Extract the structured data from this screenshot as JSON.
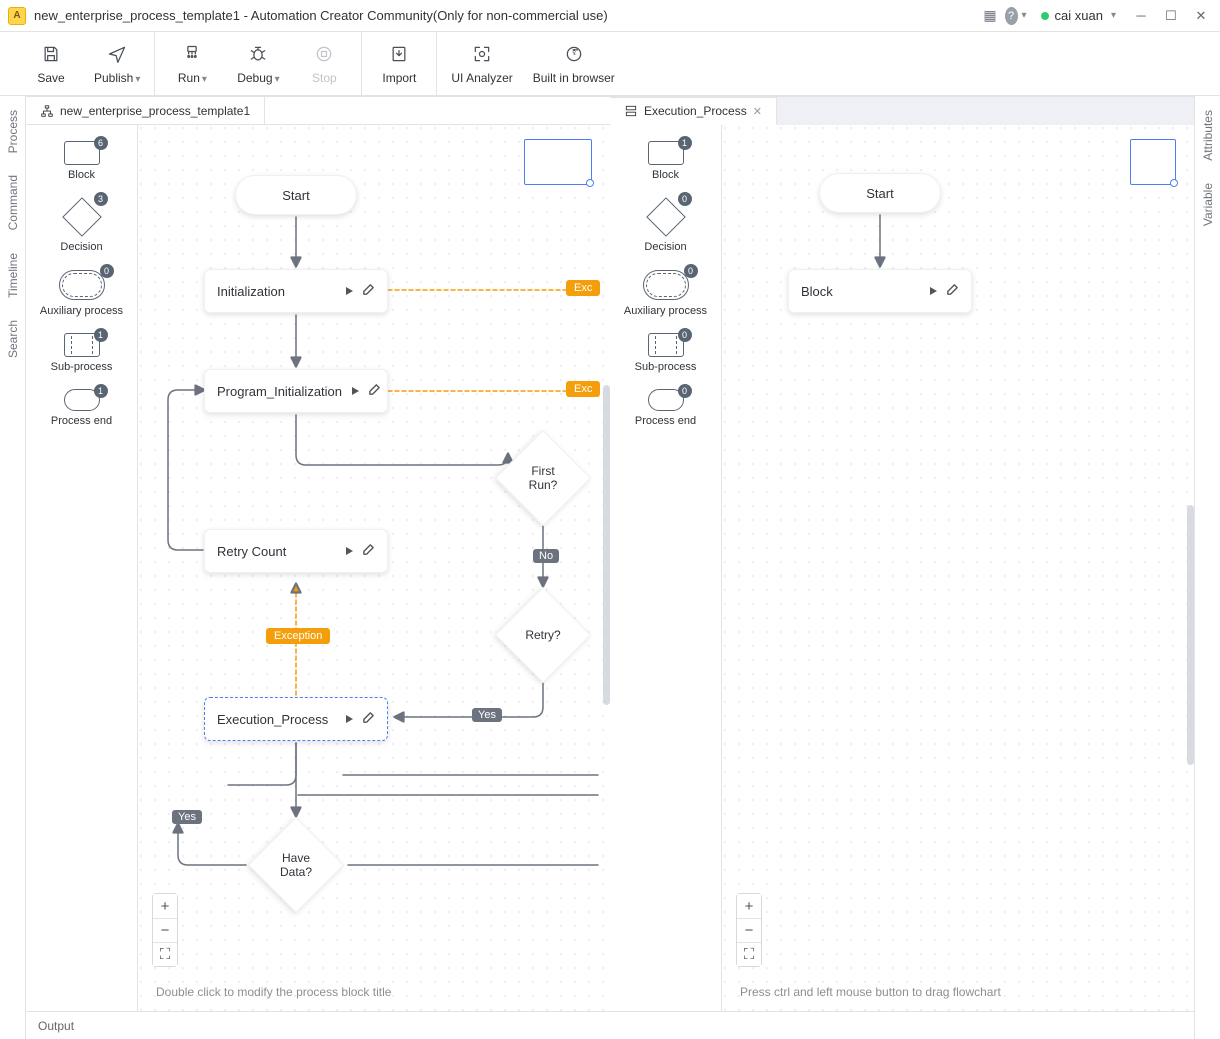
{
  "window": {
    "title": "new_enterprise_process_template1 - Automation Creator Community(Only for non-commercial use)",
    "user": "cai xuan"
  },
  "toolbar": {
    "save": "Save",
    "publish": "Publish",
    "run": "Run",
    "debug": "Debug",
    "stop": "Stop",
    "import": "Import",
    "analyzer": "UI Analyzer",
    "browser": "Built in browser"
  },
  "left_rail": {
    "process": "Process",
    "command": "Command",
    "timeline": "Timeline",
    "search": "Search"
  },
  "right_rail": {
    "attributes": "Attributes",
    "variable": "Variable"
  },
  "tabs": {
    "main": "new_enterprise_process_template1",
    "exec": "Execution_Process"
  },
  "palette_left": {
    "block": {
      "label": "Block",
      "count": "6"
    },
    "decision": {
      "label": "Decision",
      "count": "3"
    },
    "aux": {
      "label": "Auxiliary process",
      "count": "0"
    },
    "sub": {
      "label": "Sub-process",
      "count": "1"
    },
    "end": {
      "label": "Process end",
      "count": "1"
    }
  },
  "palette_right": {
    "block": {
      "label": "Block",
      "count": "1"
    },
    "decision": {
      "label": "Decision",
      "count": "0"
    },
    "aux": {
      "label": "Auxiliary process",
      "count": "0"
    },
    "sub": {
      "label": "Sub-process",
      "count": "0"
    },
    "end": {
      "label": "Process end",
      "count": "0"
    }
  },
  "flow_left": {
    "start": "Start",
    "init": "Initialization",
    "prog_init": "Program_Initialization",
    "retry_count": "Retry Count",
    "exec_proc": "Execution_Process",
    "first_run": "First\nRun?",
    "retry": "Retry?",
    "have_data": "Have\nData?",
    "exception_tag": "Exception",
    "exc_short": "Exc",
    "no": "No",
    "yes": "Yes",
    "yes2": "Yes",
    "hint": "Double click to modify the process block title"
  },
  "flow_right": {
    "start": "Start",
    "block": "Block",
    "hint": "Press ctrl and left mouse button to drag flowchart"
  },
  "output": "Output"
}
